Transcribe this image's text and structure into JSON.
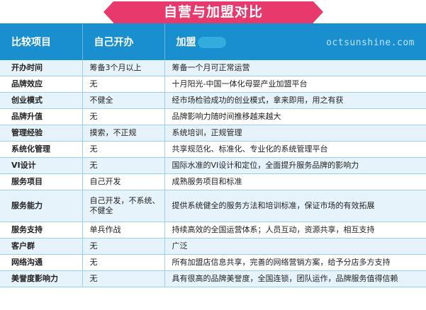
{
  "title": "自营与加盟对比",
  "watermark": "octsunshine.com",
  "header": {
    "col1": "比较项目",
    "col2": "自己开办",
    "col3": "加盟"
  },
  "rows": [
    {
      "item": "开办时间",
      "self": "筹备3个月以上",
      "franchise": "筹备一个月可正常运营"
    },
    {
      "item": "品牌效应",
      "self": "无",
      "franchise": "十月阳光-中国一体化母婴产业加盟平台"
    },
    {
      "item": "创业模式",
      "self": "不健全",
      "franchise": "经市场检验成功的创业模式，拿来即用，用之有获"
    },
    {
      "item": "品牌升值",
      "self": "无",
      "franchise": "品牌影响力随时间推移越来越大"
    },
    {
      "item": "管理经验",
      "self": "摸索，不正规",
      "franchise": "系统培训，正规管理"
    },
    {
      "item": "系统化管理",
      "self": "无",
      "franchise": "共享规范化、标准化、专业化的系统管理平台"
    },
    {
      "item": "VI设计",
      "self": "无",
      "franchise": "国际水准的VI设计和定位，全面提升服务品牌的影响力"
    },
    {
      "item": "服务项目",
      "self": "自己开发",
      "franchise": "成熟服务项目和标准"
    },
    {
      "item": "服务能力",
      "self": "自己开发，不系统、不健全",
      "franchise": "提供系统健全的服务方法和培训标准，保证市场的有效拓展"
    },
    {
      "item": "服务支持",
      "self": "单兵作战",
      "franchise": "持续高效的全国运营体系；人员互动，资源共享，相互支持"
    },
    {
      "item": "客户群",
      "self": "无",
      "franchise": "广泛"
    },
    {
      "item": "网络沟通",
      "self": "无",
      "franchise": "所有加盟店信息共享，完善的网络营销方案，给予分店多方支持"
    },
    {
      "item": "美誉度影响力",
      "self": "无",
      "franchise": "具有很高的品牌美誉度，全国连锁，团队运作，品牌服务值得信赖"
    }
  ]
}
